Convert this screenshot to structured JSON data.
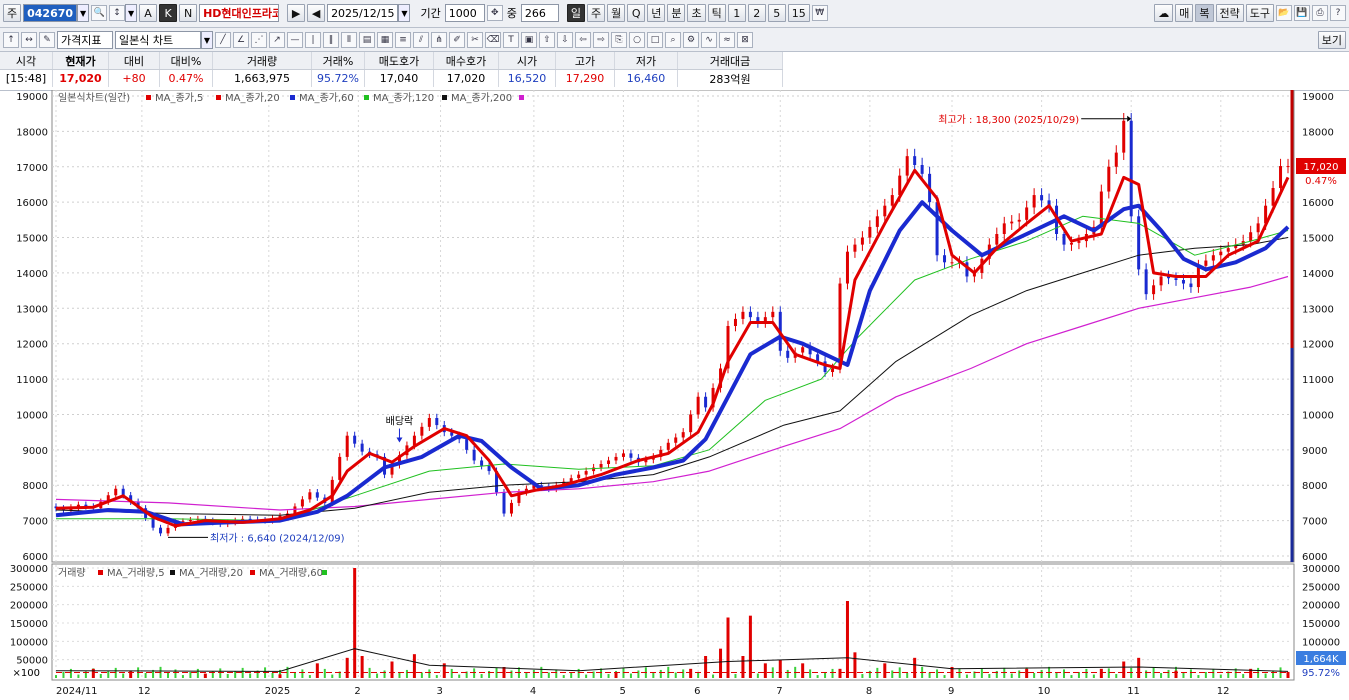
{
  "toolbar": {
    "market_prefix": "주",
    "code": "042670",
    "stock_name": "HD현대인프라코어",
    "date": "2025/12/15",
    "period_label": "기간",
    "period_value": "1000",
    "count_label": "중",
    "count_value": "266",
    "intervals": [
      "일",
      "주",
      "월",
      "Q",
      "년",
      "분",
      "초",
      "틱",
      "1",
      "2",
      "5",
      "15"
    ],
    "ab_buttons": [
      "A",
      "K",
      "N"
    ],
    "right_buttons": [
      "매",
      "복",
      "전략",
      "도구"
    ],
    "row2_select1": "가격지표",
    "row2_select2": "일본식 차트",
    "view_button": "보기"
  },
  "quote": {
    "headers": [
      "시각",
      "현재가",
      "대비",
      "대비%",
      "거래량",
      "거래%",
      "매도호가",
      "매수호가",
      "시가",
      "고가",
      "저가",
      "거래대금"
    ],
    "values": [
      "[15:48]",
      "17,020",
      "+80",
      "0.47%",
      "1,663,975",
      "95.72%",
      "17,040",
      "17,020",
      "16,520",
      "17,290",
      "16,460",
      "283억원"
    ]
  },
  "chart_data": {
    "type": "candlestick",
    "price_legend": [
      "일본식차트(일간)",
      "MA_종가,5",
      "MA_종가,20",
      "MA_종가,60",
      "MA_종가,120",
      "MA_종가,200"
    ],
    "volume_legend": [
      "거래량",
      "MA_거래량,5",
      "MA_거래량,20",
      "MA_거래량,60"
    ],
    "price_axis": [
      6000,
      7000,
      8000,
      9000,
      10000,
      11000,
      12000,
      13000,
      14000,
      15000,
      16000,
      17000,
      18000,
      19000
    ],
    "volume_axis": [
      50000,
      100000,
      150000,
      200000,
      250000,
      300000
    ],
    "volume_unit": "×100",
    "months": [
      "2024/11",
      "12",
      "2025",
      "2",
      "3",
      "4",
      "5",
      "6",
      "7",
      "8",
      "9",
      "10",
      "11",
      "12"
    ],
    "annotations": {
      "high": "최고가 : 18,300 (2025/10/29)",
      "low": "최저가 : 6,640 (2024/12/09)",
      "dividend": "배당락"
    },
    "last_price": "17,020",
    "last_change": "0.47%",
    "last_volume": "1,664K",
    "last_volume_pct": "95.72%",
    "price_path": [
      [
        0,
        7400
      ],
      [
        4,
        7300
      ],
      [
        8,
        7450
      ],
      [
        12,
        7350
      ],
      [
        18,
        7900
      ],
      [
        24,
        7350
      ],
      [
        28,
        6800
      ],
      [
        30,
        6640
      ],
      [
        34,
        6950
      ],
      [
        40,
        7050
      ],
      [
        46,
        6900
      ],
      [
        52,
        7050
      ],
      [
        58,
        7000
      ],
      [
        64,
        7200
      ],
      [
        70,
        7800
      ],
      [
        74,
        7500
      ],
      [
        78,
        8800
      ],
      [
        80,
        9400
      ],
      [
        84,
        8950
      ],
      [
        88,
        8800
      ],
      [
        90,
        8300
      ],
      [
        94,
        8850
      ],
      [
        98,
        9400
      ],
      [
        102,
        9900
      ],
      [
        106,
        9500
      ],
      [
        110,
        9300
      ],
      [
        114,
        8700
      ],
      [
        118,
        8400
      ],
      [
        120,
        7800
      ],
      [
        122,
        7200
      ],
      [
        126,
        7800
      ],
      [
        130,
        8000
      ],
      [
        134,
        7900
      ],
      [
        138,
        8100
      ],
      [
        142,
        8300
      ],
      [
        146,
        8500
      ],
      [
        150,
        8700
      ],
      [
        154,
        8900
      ],
      [
        158,
        8650
      ],
      [
        162,
        8800
      ],
      [
        166,
        9200
      ],
      [
        170,
        9500
      ],
      [
        174,
        10500
      ],
      [
        176,
        10200
      ],
      [
        180,
        11300
      ],
      [
        182,
        12500
      ],
      [
        186,
        12900
      ],
      [
        190,
        12600
      ],
      [
        194,
        12900
      ],
      [
        196,
        11800
      ],
      [
        198,
        11600
      ],
      [
        202,
        11900
      ],
      [
        206,
        11500
      ],
      [
        208,
        11200
      ],
      [
        210,
        11300
      ],
      [
        212,
        13700
      ],
      [
        214,
        14600
      ],
      [
        218,
        15000
      ],
      [
        222,
        15600
      ],
      [
        226,
        16200
      ],
      [
        230,
        17300
      ],
      [
        234,
        16800
      ],
      [
        236,
        16000
      ],
      [
        238,
        14500
      ],
      [
        240,
        14300
      ],
      [
        244,
        14300
      ],
      [
        246,
        13900
      ],
      [
        248,
        14000
      ],
      [
        252,
        14800
      ],
      [
        256,
        15400
      ],
      [
        260,
        15500
      ],
      [
        264,
        16200
      ],
      [
        268,
        15900
      ],
      [
        270,
        15100
      ],
      [
        272,
        14800
      ],
      [
        276,
        14900
      ],
      [
        280,
        15300
      ],
      [
        282,
        16300
      ],
      [
        284,
        17000
      ],
      [
        286,
        17400
      ],
      [
        288,
        18300
      ],
      [
        290,
        15600
      ],
      [
        292,
        14100
      ],
      [
        294,
        13400
      ],
      [
        298,
        13900
      ],
      [
        302,
        13800
      ],
      [
        306,
        13600
      ],
      [
        308,
        14200
      ],
      [
        312,
        14500
      ],
      [
        316,
        14700
      ],
      [
        320,
        14900
      ],
      [
        324,
        15400
      ],
      [
        328,
        16400
      ],
      [
        330,
        17020
      ]
    ],
    "ma5": [
      [
        0,
        7350
      ],
      [
        10,
        7380
      ],
      [
        18,
        7700
      ],
      [
        26,
        7100
      ],
      [
        32,
        6850
      ],
      [
        40,
        7000
      ],
      [
        50,
        6950
      ],
      [
        60,
        7050
      ],
      [
        68,
        7300
      ],
      [
        74,
        7700
      ],
      [
        78,
        8400
      ],
      [
        84,
        8900
      ],
      [
        90,
        8650
      ],
      [
        96,
        9100
      ],
      [
        104,
        9600
      ],
      [
        110,
        9400
      ],
      [
        116,
        8700
      ],
      [
        122,
        7700
      ],
      [
        128,
        7850
      ],
      [
        136,
        8000
      ],
      [
        146,
        8300
      ],
      [
        156,
        8700
      ],
      [
        164,
        8900
      ],
      [
        172,
        9500
      ],
      [
        176,
        10300
      ],
      [
        180,
        11500
      ],
      [
        186,
        12600
      ],
      [
        192,
        12600
      ],
      [
        198,
        11700
      ],
      [
        206,
        11400
      ],
      [
        210,
        11300
      ],
      [
        214,
        13800
      ],
      [
        222,
        15400
      ],
      [
        230,
        16900
      ],
      [
        236,
        16100
      ],
      [
        240,
        14500
      ],
      [
        246,
        14000
      ],
      [
        252,
        14700
      ],
      [
        260,
        15400
      ],
      [
        266,
        15900
      ],
      [
        272,
        14900
      ],
      [
        280,
        15100
      ],
      [
        286,
        16700
      ],
      [
        290,
        16500
      ],
      [
        294,
        14000
      ],
      [
        300,
        13900
      ],
      [
        308,
        13900
      ],
      [
        314,
        14500
      ],
      [
        322,
        14900
      ],
      [
        330,
        16700
      ]
    ],
    "ma20": [
      [
        0,
        7150
      ],
      [
        14,
        7300
      ],
      [
        24,
        7250
      ],
      [
        34,
        6900
      ],
      [
        46,
        6950
      ],
      [
        60,
        7000
      ],
      [
        70,
        7250
      ],
      [
        78,
        7700
      ],
      [
        88,
        8500
      ],
      [
        98,
        8800
      ],
      [
        108,
        9400
      ],
      [
        114,
        9250
      ],
      [
        122,
        8500
      ],
      [
        130,
        7900
      ],
      [
        140,
        8000
      ],
      [
        150,
        8300
      ],
      [
        160,
        8500
      ],
      [
        168,
        8700
      ],
      [
        174,
        9300
      ],
      [
        180,
        10500
      ],
      [
        186,
        11700
      ],
      [
        194,
        12200
      ],
      [
        200,
        12000
      ],
      [
        208,
        11600
      ],
      [
        212,
        11400
      ],
      [
        218,
        13500
      ],
      [
        226,
        15200
      ],
      [
        232,
        16000
      ],
      [
        240,
        15200
      ],
      [
        248,
        14500
      ],
      [
        254,
        14800
      ],
      [
        262,
        15200
      ],
      [
        270,
        15600
      ],
      [
        278,
        15200
      ],
      [
        286,
        15800
      ],
      [
        290,
        15900
      ],
      [
        296,
        15200
      ],
      [
        302,
        14400
      ],
      [
        308,
        14100
      ],
      [
        316,
        14300
      ],
      [
        324,
        14700
      ],
      [
        330,
        15300
      ]
    ],
    "ma60": [
      [
        0,
        7050
      ],
      [
        30,
        7050
      ],
      [
        60,
        7000
      ],
      [
        80,
        7700
      ],
      [
        100,
        8400
      ],
      [
        120,
        8600
      ],
      [
        140,
        8450
      ],
      [
        160,
        8550
      ],
      [
        175,
        9000
      ],
      [
        190,
        10400
      ],
      [
        205,
        11000
      ],
      [
        215,
        12200
      ],
      [
        230,
        13800
      ],
      [
        245,
        14400
      ],
      [
        260,
        14900
      ],
      [
        275,
        15600
      ],
      [
        290,
        15400
      ],
      [
        305,
        14500
      ],
      [
        320,
        14900
      ],
      [
        330,
        15200
      ]
    ],
    "ma120": [
      [
        0,
        7300
      ],
      [
        30,
        7200
      ],
      [
        60,
        7150
      ],
      [
        80,
        7350
      ],
      [
        100,
        7800
      ],
      [
        120,
        8000
      ],
      [
        140,
        8100
      ],
      [
        160,
        8300
      ],
      [
        175,
        8800
      ],
      [
        195,
        9700
      ],
      [
        210,
        10100
      ],
      [
        225,
        11500
      ],
      [
        245,
        12800
      ],
      [
        260,
        13500
      ],
      [
        275,
        14000
      ],
      [
        290,
        14500
      ],
      [
        305,
        14700
      ],
      [
        320,
        14800
      ],
      [
        330,
        15000
      ]
    ],
    "ma200": [
      [
        0,
        7600
      ],
      [
        30,
        7500
      ],
      [
        60,
        7300
      ],
      [
        80,
        7400
      ],
      [
        100,
        7600
      ],
      [
        120,
        7800
      ],
      [
        140,
        7900
      ],
      [
        160,
        8100
      ],
      [
        175,
        8400
      ],
      [
        195,
        9100
      ],
      [
        210,
        9600
      ],
      [
        225,
        10500
      ],
      [
        245,
        11300
      ],
      [
        260,
        12000
      ],
      [
        275,
        12500
      ],
      [
        290,
        13000
      ],
      [
        305,
        13300
      ],
      [
        320,
        13600
      ],
      [
        330,
        13900
      ]
    ],
    "volume_bars": [
      [
        10,
        25000
      ],
      [
        20,
        18000
      ],
      [
        40,
        12000
      ],
      [
        60,
        10000
      ],
      [
        70,
        40000
      ],
      [
        78,
        55000
      ],
      [
        80,
        300000
      ],
      [
        82,
        60000
      ],
      [
        90,
        45000
      ],
      [
        96,
        65000
      ],
      [
        104,
        40000
      ],
      [
        120,
        30000
      ],
      [
        150,
        15000
      ],
      [
        170,
        25000
      ],
      [
        174,
        60000
      ],
      [
        178,
        80000
      ],
      [
        180,
        165000
      ],
      [
        184,
        60000
      ],
      [
        186,
        170000
      ],
      [
        190,
        40000
      ],
      [
        194,
        50000
      ],
      [
        200,
        40000
      ],
      [
        210,
        25000
      ],
      [
        212,
        210000
      ],
      [
        214,
        70000
      ],
      [
        222,
        40000
      ],
      [
        230,
        55000
      ],
      [
        240,
        30000
      ],
      [
        260,
        25000
      ],
      [
        280,
        25000
      ],
      [
        286,
        45000
      ],
      [
        290,
        55000
      ],
      [
        300,
        20000
      ],
      [
        320,
        25000
      ],
      [
        330,
        16640
      ]
    ]
  }
}
